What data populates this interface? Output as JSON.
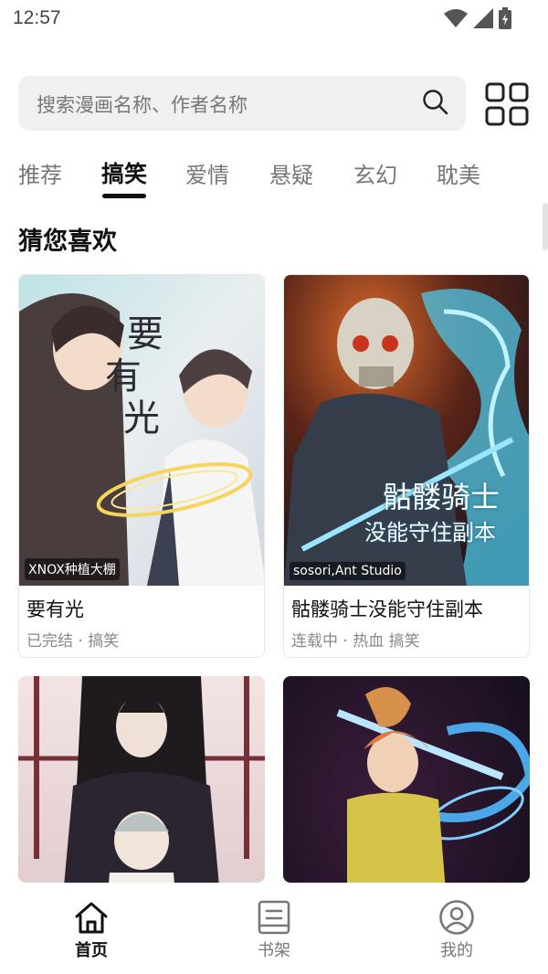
{
  "status_bar": {
    "time": "12:57",
    "icons": [
      "wifi-icon",
      "cell-signal-icon",
      "battery-charging-icon"
    ]
  },
  "search": {
    "placeholder": "搜索漫画名称、作者名称",
    "icon": "search-icon"
  },
  "category_menu_icon": "grid-icon",
  "tabs": [
    {
      "label": "推荐",
      "active": false
    },
    {
      "label": "搞笑",
      "active": true
    },
    {
      "label": "爱情",
      "active": false
    },
    {
      "label": "悬疑",
      "active": false
    },
    {
      "label": "玄幻",
      "active": false
    },
    {
      "label": "耽美",
      "active": false
    }
  ],
  "section": {
    "title": "猜您喜欢"
  },
  "comics": [
    {
      "title": "要有光",
      "author": "XNOX种植大棚",
      "meta": "已完结 · 搞笑",
      "cover_text": [
        "要",
        "有",
        "光"
      ]
    },
    {
      "title": "骷髅骑士没能守住副本",
      "author": "sosori,Ant Studio",
      "meta": "连载中 · 热血 搞笑",
      "cover_text": [
        "骷髅骑士",
        "没能守住副本"
      ]
    },
    {
      "title": "",
      "author": "",
      "meta": ""
    },
    {
      "title": "",
      "author": "",
      "meta": ""
    }
  ],
  "bottom_nav": [
    {
      "label": "首页",
      "icon": "home-icon",
      "active": true
    },
    {
      "label": "书架",
      "icon": "bookshelf-icon",
      "active": false
    },
    {
      "label": "我的",
      "icon": "profile-icon",
      "active": false
    }
  ],
  "colors": {
    "background": "#ffffff",
    "search_bg": "#f0f0f0",
    "active_text": "#111111",
    "inactive_text": "#777777"
  }
}
